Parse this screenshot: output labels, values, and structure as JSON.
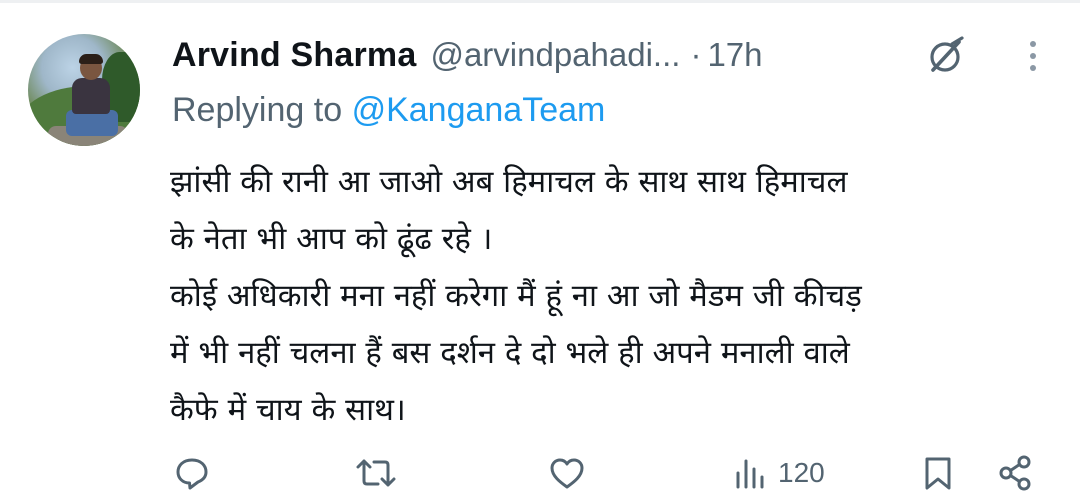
{
  "tweet": {
    "display_name": "Arvind Sharma",
    "handle": "@arvindpahadi...",
    "separator": "·",
    "time": "17h",
    "replying_prefix": "Replying to",
    "replying_to": "@KanganaTeam",
    "body_lines": [
      "झांसी की रानी आ जाओ अब हिमाचल के साथ साथ हिमाचल",
      "के नेता भी आप को ढूंढ रहे ।",
      "कोई अधिकारी मना नहीं करेगा मैं हूं ना आ जो मैडम जी कीचड़",
      "में भी नहीं चलना हैं बस दर्शन दे दो भले ही अपने मनाली वाले",
      "कैफे में चाय के साथ।"
    ],
    "icons": {
      "header": [
        "grok-icon",
        "more-icon"
      ],
      "actions": [
        "reply-icon",
        "retweet-icon",
        "like-icon",
        "views-icon",
        "bookmark-icon",
        "share-icon"
      ]
    },
    "views": "120"
  },
  "colors": {
    "text": "#0f1419",
    "secondary": "#536471",
    "mention": "#1d9bf0",
    "background": "#ffffff"
  }
}
